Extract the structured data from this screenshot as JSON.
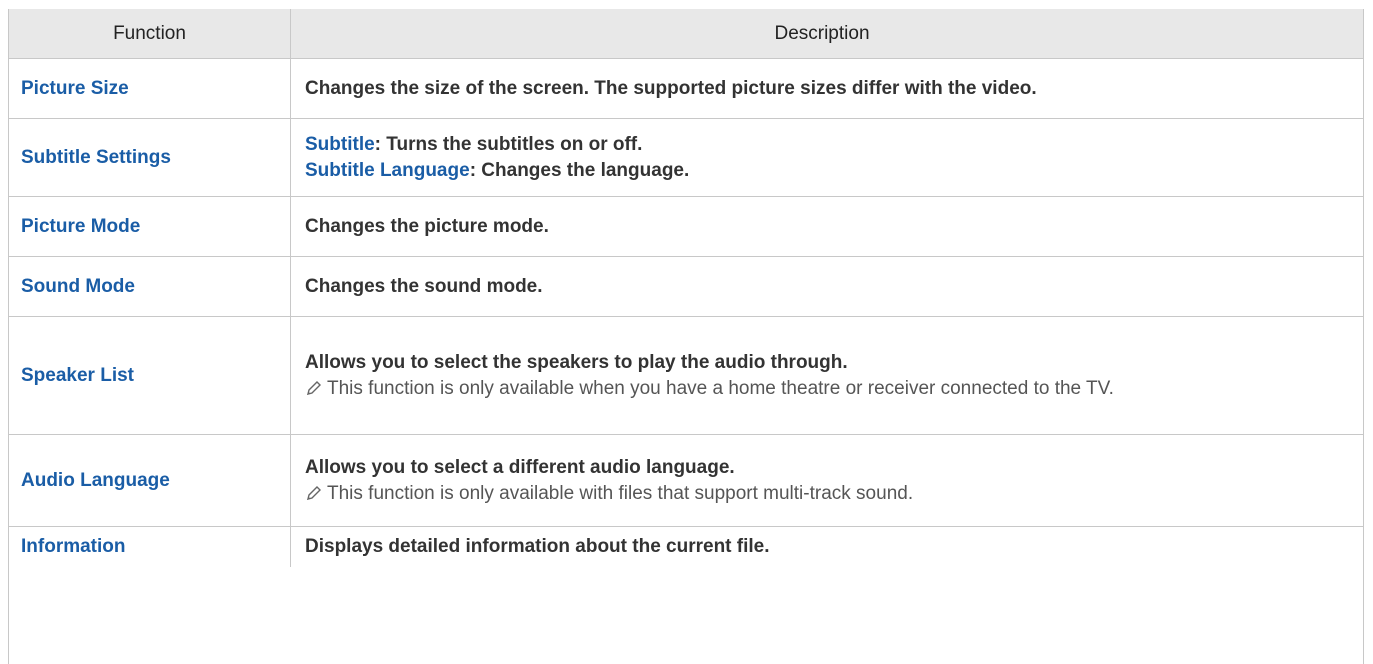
{
  "table": {
    "headers": {
      "function": "Function",
      "description": "Description"
    },
    "rows": [
      {
        "function": "Picture Size",
        "description": "Changes the size of the screen. The supported picture sizes differ with the video."
      },
      {
        "function": "Subtitle Settings",
        "items": [
          {
            "term": "Subtitle",
            "text": ": Turns the subtitles on or off."
          },
          {
            "term": "Subtitle Language",
            "text": ": Changes the language."
          }
        ]
      },
      {
        "function": "Picture Mode",
        "description": "Changes the picture mode."
      },
      {
        "function": "Sound Mode",
        "description": "Changes the sound mode."
      },
      {
        "function": "Speaker List",
        "description": "Allows you to select the speakers to play the audio through.",
        "note": "This function is only available when you have a home theatre or receiver connected to the TV."
      },
      {
        "function": "Audio Language",
        "description": "Allows you to select a different audio language.",
        "note": "This function is only available with files that support multi-track sound."
      },
      {
        "function": "Information",
        "description": "Displays detailed information about the current file."
      }
    ]
  },
  "colors": {
    "link_blue": "#1a5da6",
    "header_bg": "#e8e8e8",
    "border": "#c8c8c8",
    "note_icon": "pencil-icon"
  }
}
